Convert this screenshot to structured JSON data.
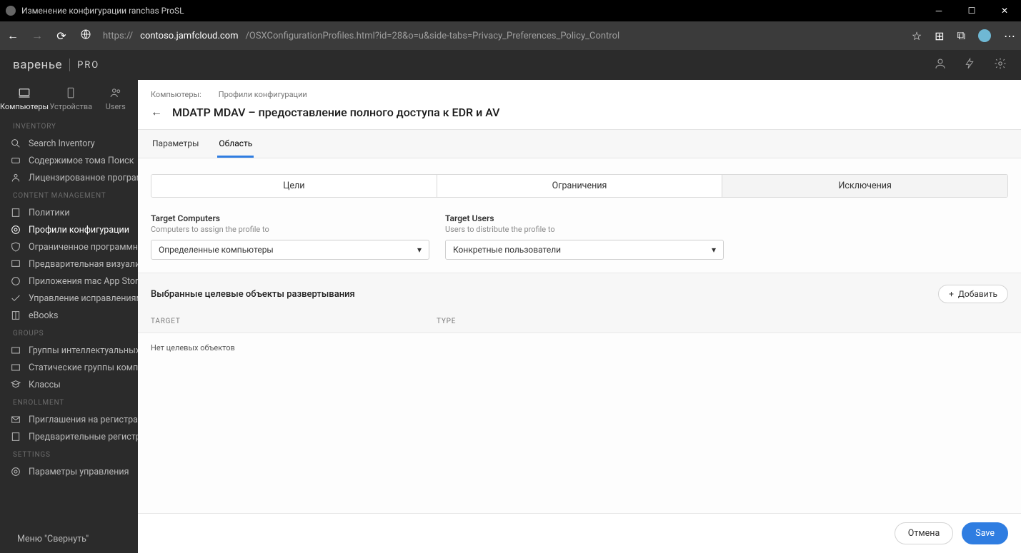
{
  "window": {
    "title": "Изменение конфигурации ranchas ProSL"
  },
  "browser": {
    "url_host": "contoso.jamfcloud.com",
    "url_prefix": "https://",
    "url_path": "/OSXConfigurationProfiles.html?id=28&o=u&side-tabs=Privacy_Preferences_Policy_Control"
  },
  "brand": {
    "name": "варенье",
    "tier": "PRO"
  },
  "topTabs": {
    "computers": "Компьютеры",
    "devices": "Устройства",
    "users": "Users"
  },
  "sidebar": {
    "inventory": {
      "head": "INVENTORY",
      "search": "Search Inventory",
      "volume": "Содержимое тома Поиск",
      "licensed": "Лицензированное программное об"
    },
    "content": {
      "head": "CONTENT MANAGEMENT",
      "policies": "Политики",
      "profiles": "Профили конфигурации",
      "restricted": "Ограниченное программное обесп",
      "preview": "Предварительная визуализация",
      "macapp": "Приложения mac App Store",
      "patches": "Управление исправлениями",
      "ebooks": "eBooks"
    },
    "groups": {
      "head": "GROUPS",
      "smart": "Группы интеллектуальных компьютер",
      "static": "Статические группы компьютеров",
      "classes": "Классы"
    },
    "enrollment": {
      "head": "ENROLLMENT",
      "invites": "Приглашения на регистрацию",
      "prereg": "Предварительные регистрации"
    },
    "settings": {
      "head": "SETTINGS",
      "mgmt": "Параметры управления"
    },
    "collapse": "Меню \"Свернуть\""
  },
  "breadcrumbs": {
    "root": "Компьютеры:",
    "section": "Профили конфигурации"
  },
  "page_title": "MDATP MDAV – предоставление полного доступа к EDR и AV",
  "subtabs": {
    "options": "Параметры",
    "scope": "Область"
  },
  "segments": {
    "targets": "Цели",
    "limitations": "Ограничения",
    "exclusions": "Исключения"
  },
  "fields": {
    "targetComputers": {
      "label": "Target Computers",
      "help": "Computers to assign the profile to",
      "value": "Определенные компьютеры"
    },
    "targetUsers": {
      "label": "Target Users",
      "help": "Users to distribute the profile to",
      "value": "Конкретные пользователи"
    }
  },
  "deploy": {
    "heading": "Выбранные целевые объекты развертывания",
    "add": "Добавить",
    "col_target": "TARGET",
    "col_type": "TYPE",
    "empty": "Нет целевых объектов"
  },
  "footer": {
    "cancel": "Отмена",
    "save": "Save"
  }
}
